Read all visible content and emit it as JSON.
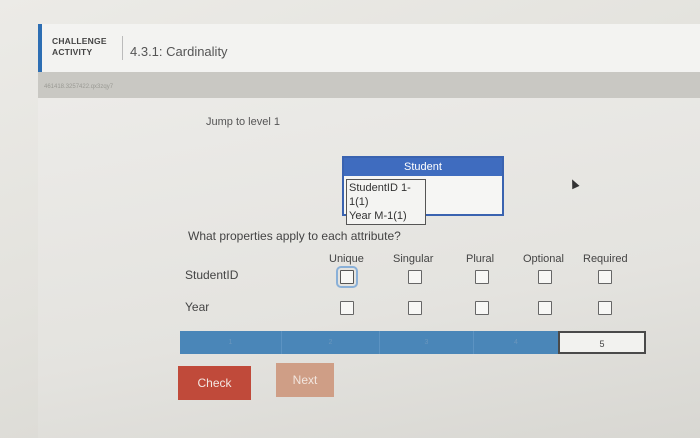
{
  "header": {
    "challenge_line1": "CHALLENGE",
    "challenge_line2": "ACTIVITY",
    "title": "4.3.1: Cardinality"
  },
  "subheader": {
    "id_text": "461418.3257422.qx3zqy7"
  },
  "jump_link": "Jump to level 1",
  "entity": {
    "name": "Student",
    "attributes": [
      "StudentID 1-1(1)",
      "Year M-1(1)"
    ]
  },
  "question": "What properties apply to each attribute?",
  "columns": [
    "Unique",
    "Singular",
    "Plural",
    "Optional",
    "Required"
  ],
  "rows": [
    "StudentID",
    "Year"
  ],
  "progress": {
    "levels": [
      "1",
      "2",
      "3",
      "4",
      "5"
    ],
    "current_level": "5"
  },
  "buttons": {
    "check": "Check",
    "next": "Next"
  },
  "colors": {
    "accent": "#3f6cbf",
    "progress": "#4a86b8",
    "check": "#c04a3a",
    "next": "#cf9e86"
  }
}
